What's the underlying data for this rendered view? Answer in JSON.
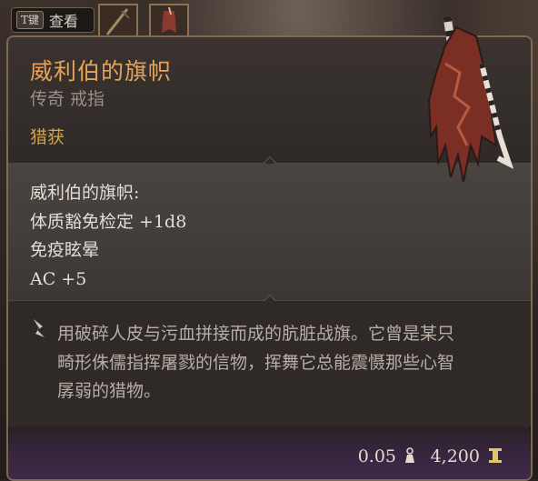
{
  "hotbar": {
    "key_label": "T键",
    "view_label": "查看"
  },
  "tooltip": {
    "item_name": "威利伯的旗帜",
    "subtitle": "传奇 戒指",
    "tag": "猎获",
    "stats_header": "威利伯的旗帜:",
    "stats": [
      "体质豁免检定 +1d8",
      "免疫眩晕",
      "AC +5"
    ],
    "description_lines": [
      "用破碎人皮与污血拼接而成的肮脏战旗。它曾是某只",
      "畸形侏儒指挥屠戮的信物，挥舞它总能震慑那些心智",
      "孱弱的猎物。"
    ],
    "weight": "0.05",
    "price": "4,200"
  },
  "colors": {
    "title": "#e5a35a",
    "tag": "#d6a447",
    "border": "#7c6a55",
    "footer_tint": "#3d2a48"
  },
  "icons": {
    "description": "quill-icon",
    "weight": "weight-icon",
    "price": "gold-coin-icon",
    "item": "tattered-banner-icon"
  }
}
